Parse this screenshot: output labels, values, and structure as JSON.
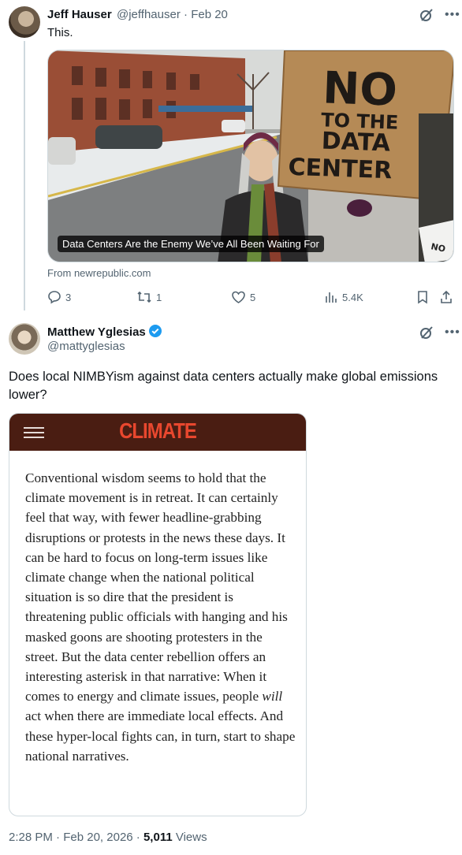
{
  "tweet1": {
    "name": "Jeff Hauser",
    "handle": "@jeffhauser",
    "separator": "·",
    "date": "Feb 20",
    "text": "This.",
    "card": {
      "caption": "Data Centers Are the Enemy We’ve All Been Waiting For",
      "sign_text": [
        "NO",
        "TO THE",
        "DATA",
        "CENTER"
      ],
      "small_sign_text": "NO",
      "source": "From newrepublic.com"
    },
    "actions": {
      "replies": "3",
      "reposts": "1",
      "likes": "5",
      "views": "5.4K"
    }
  },
  "tweet2": {
    "name": "Matthew Yglesias",
    "handle": "@mattyglesias",
    "text": "Does local NIMBYism against data centers actually make global emissions lower?",
    "article": {
      "section": "CLIMATE",
      "body_before": "Conventional wisdom seems to hold that the climate movement is in retreat. It can certainly feel that way, with fewer headline-grabbing disruptions or protests in the news these days. It can be hard to focus on long-term issues like climate change when the national political situation is so dire that the president is threatening public officials with hanging and his masked goons are shooting protesters in the street. But the data center rebellion offers an interesting asterisk in that narrative: When it comes to energy and climate issues, people ",
      "body_emphasis": "will",
      "body_after": " act when there are immediate local effects. And these hyper-local fights can, in turn, start to shape national narratives."
    },
    "meta": {
      "time": "2:28 PM",
      "separator": "·",
      "date": "Feb 20, 2026",
      "views_count": "5,011",
      "views_label": "Views"
    }
  },
  "colors": {
    "text": "#0f1419",
    "secondary": "#536471",
    "verified": "#1d9bf0",
    "article_header": "#4a1d12",
    "article_section": "#e8472e"
  }
}
